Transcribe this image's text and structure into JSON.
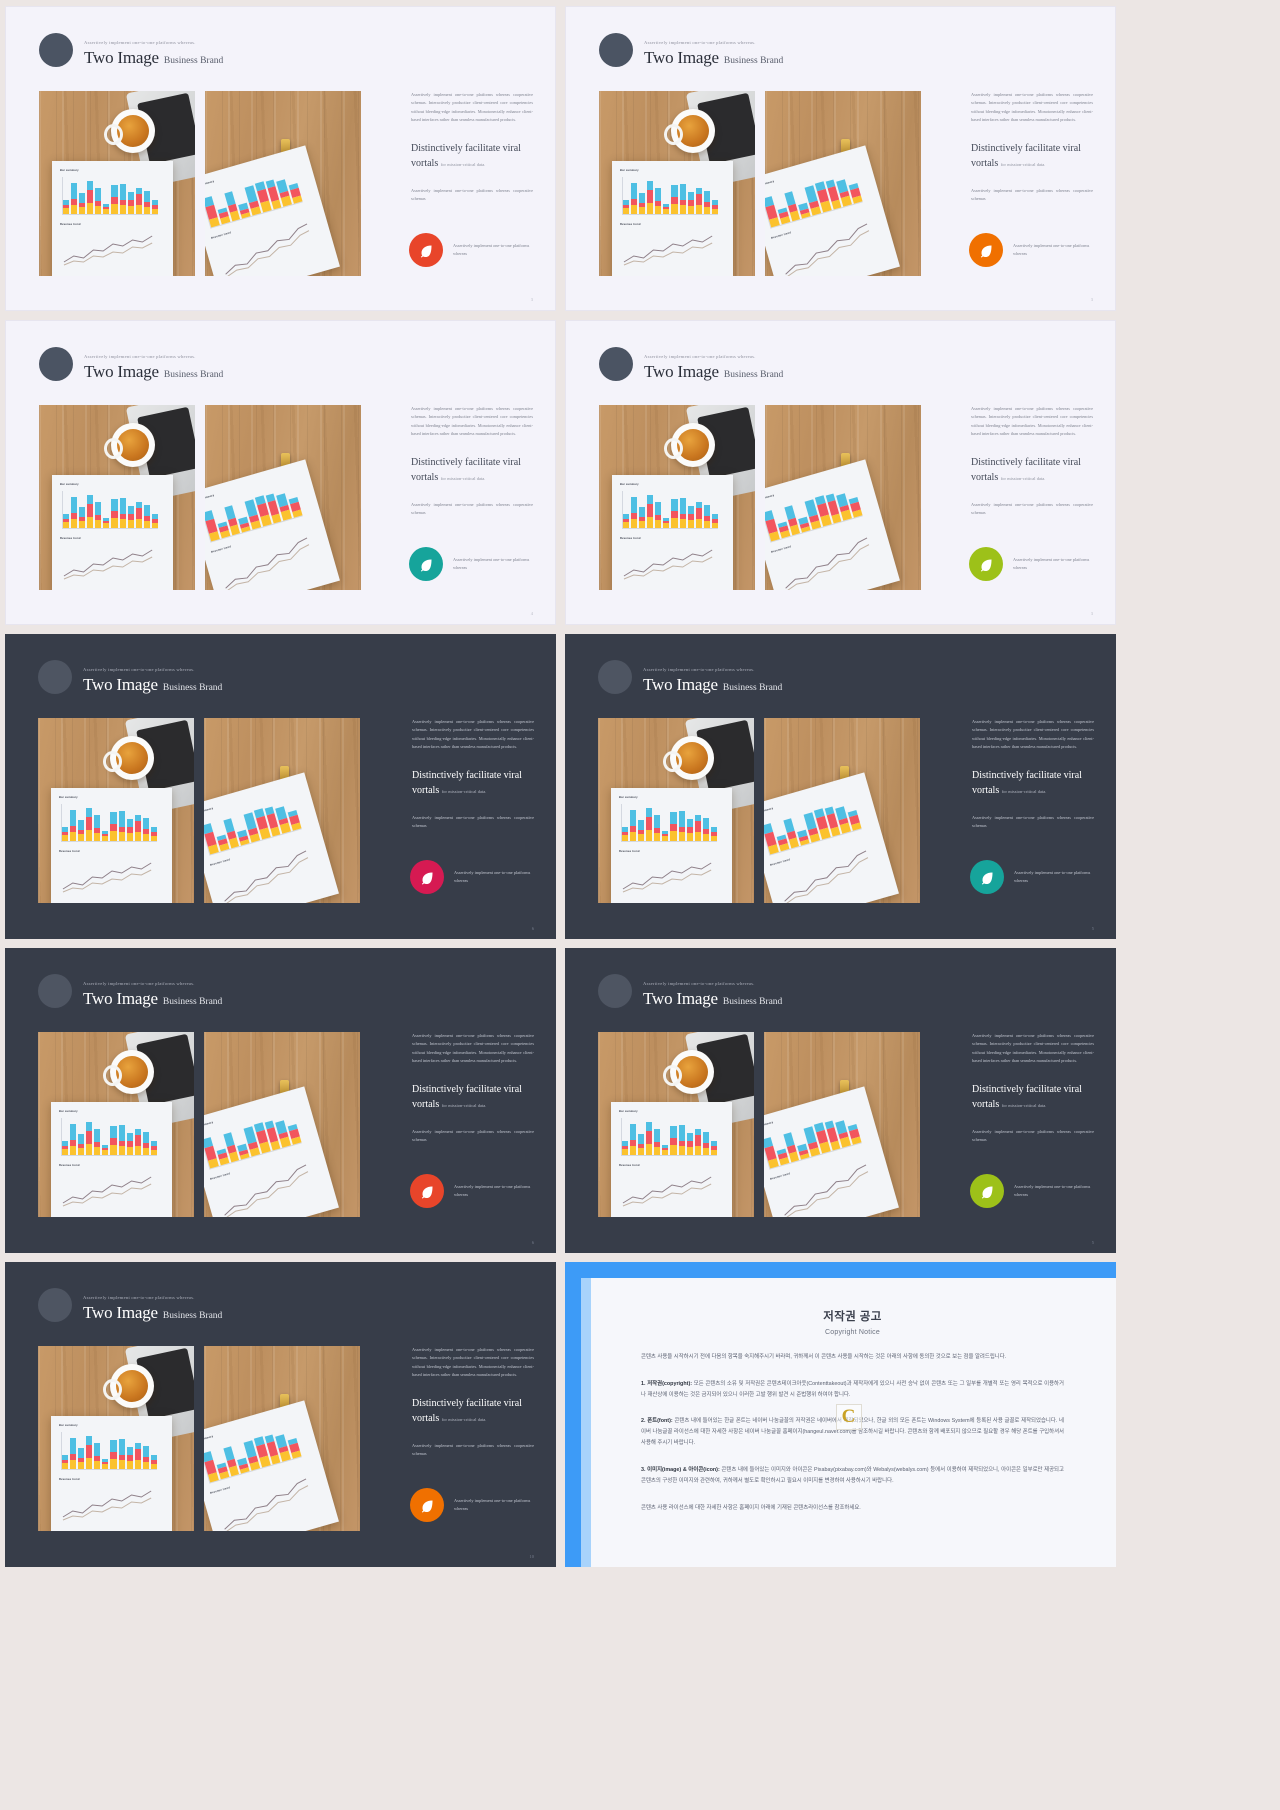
{
  "deck": {
    "slide_title_main": "Two Image",
    "slide_title_sub": "Business Brand",
    "eyebrow": "Assertively implement one-to-one platforms whereas.",
    "body_paragraph": "Assertively implement one-to-one platforms whereas cooperative schemas. Interactively productize client-centered core competencies without bleeding-edge infomediaries. Monotonectally enhance client-based interfaces rather than seamless manufactured products.",
    "highlight_heading": "Distinctively facilitate viral vortals",
    "highlight_small": "for mission-critical data.",
    "secondary_paragraph": "Assertively implement one-to-one platforms whereas cooperative schemas",
    "cta_text": "Assertively implement one-to-one platforms whereas",
    "cta_icon": "leaf-icon"
  },
  "slides": [
    {
      "theme": "light",
      "accent": "#e8452a",
      "page_number": "3"
    },
    {
      "theme": "light",
      "accent": "#f07000",
      "page_number": "3"
    },
    {
      "theme": "light",
      "accent": "#16a49b",
      "page_number": "4"
    },
    {
      "theme": "light",
      "accent": "#9dc119",
      "page_number": "3"
    },
    {
      "theme": "dark",
      "accent": "#d61a52",
      "page_number": "6"
    },
    {
      "theme": "dark",
      "accent": "#16a49b",
      "page_number": "5"
    },
    {
      "theme": "dark",
      "accent": "#e8452a",
      "page_number": "6"
    },
    {
      "theme": "dark",
      "accent": "#9dc119",
      "page_number": "5"
    },
    {
      "theme": "dark",
      "accent": "#f07000",
      "page_number": "10"
    }
  ],
  "copyright": {
    "title_ko": "저작권 공고",
    "title_en": "Copyright Notice",
    "intro": "콘텐츠 사용을 시작하시기 전에 다음의 항목을 숙지해주시기 바라며, 귀하께서 이 콘텐츠 사용을 시작하는 것은 아래의 사항에 동의한 것으로 보는 점을 알려드립니다.",
    "items": [
      {
        "label": "1. 저작권(copyright):",
        "text": "모든 콘텐츠의 소유 및 저작권은 콘텐츠테이크아웃(Contenttakeout)과 제작자에게 있으니 사전 승낙 없이 콘텐츠 또는 그 일부를 개별적 또는 영리 목적으로 이용하거나 재산상에 이용하는 것은 금지되어 있으니 이러한 고발 행위 발견 시 준법행위 하여야 합니다."
      },
      {
        "label": "2. 폰트(font):",
        "text": "콘텐츠 내에 들어있는 한글 폰트는 네이버 나눔글꼴의 저작권은 네이버에서 제작되었으나, 한글 외의 모든 폰트는 Windows System에 등록된 사용 글꼴로 제작되었습니다. 네이버 나눔글꼴 라이선스에 대한 자세한 사항은 네이버 나눔글꼴 홈페이지(hangeul.naver.com)를 참조하시길 바랍니다. 콘텐츠와 함께 배포되지 않으므로 필요할 경우 해당 폰트를 구입하셔서 사용해 주시기 바랍니다."
      },
      {
        "label": "3. 이미지(image) & 아이콘(icon):",
        "text": "콘텐츠 내에 들어있는 이미지와 아이콘은 Pixabay(pixabay.com)와 Webalys(webalys.com) 등에서 이용하여 제작되었으니, 아이콘은 일부로만 제공되고 콘텐츠의 구성한 이미지와 관련하여, 귀하께서 별도로 확인하시고 필요시 이미지를 변경하여 사용하시기 바랍니다."
      }
    ],
    "footer": "콘텐츠 사용 라이선스에 대한 자세한 사항은 홈페이지 아래에 기재된 콘텐츠라이선스를 참조하세요.",
    "watermark": "C"
  }
}
